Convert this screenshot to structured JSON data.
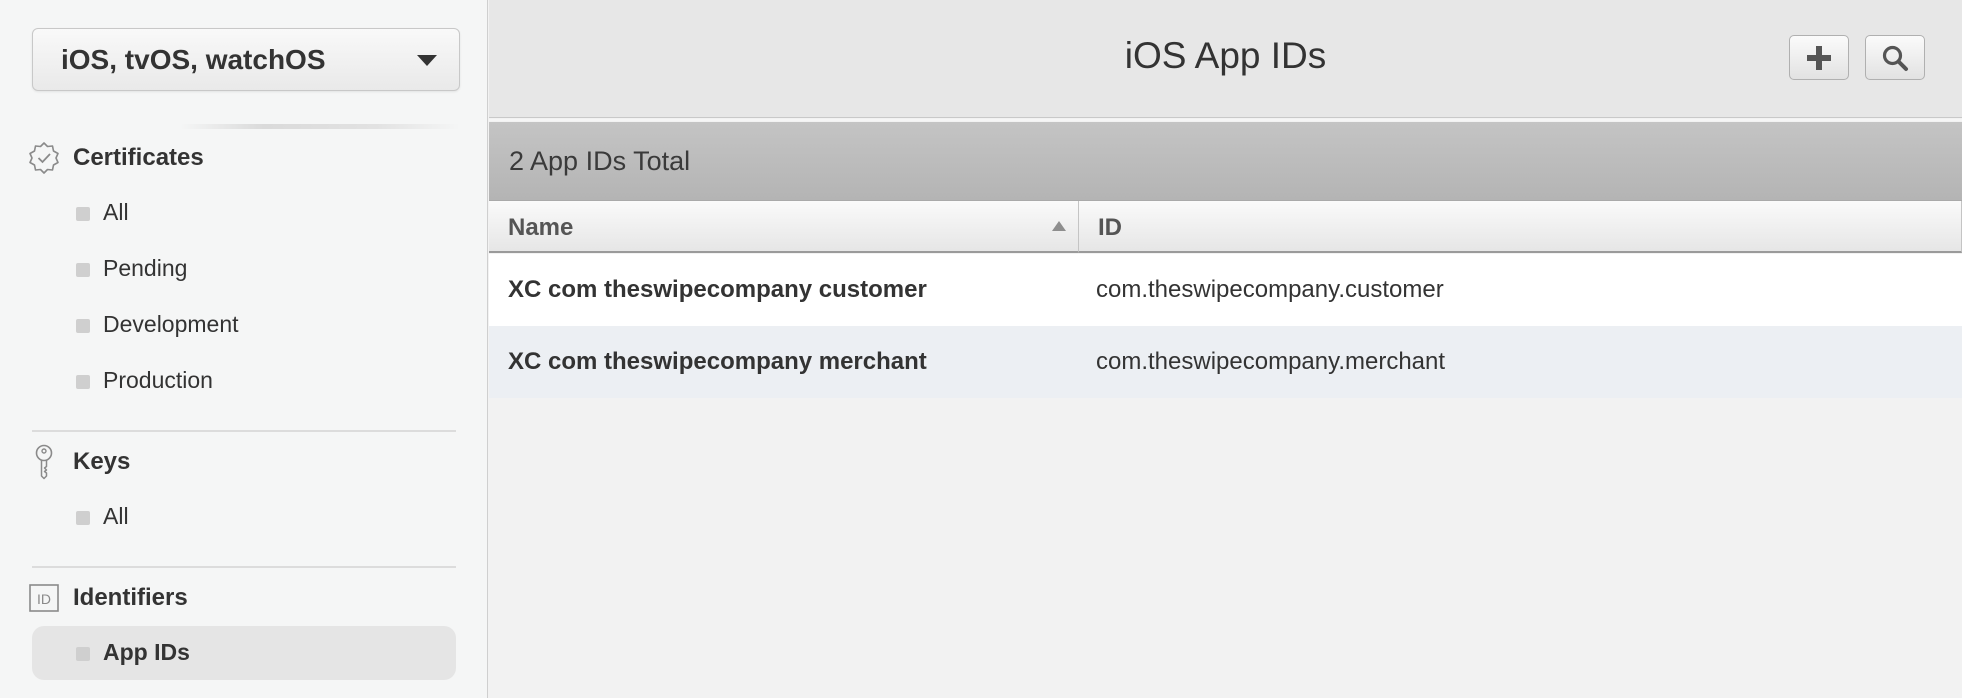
{
  "sidebar": {
    "platform_select": {
      "value": "iOS, tvOS, watchOS"
    },
    "sections": {
      "certificates": {
        "title": "Certificates",
        "icon": "badge-icon",
        "items": [
          "All",
          "Pending",
          "Development",
          "Production"
        ]
      },
      "keys": {
        "title": "Keys",
        "icon": "key-icon",
        "items": [
          "All"
        ]
      },
      "identifiers": {
        "title": "Identifiers",
        "icon": "id-icon",
        "icon_text": "ID",
        "items": [
          "App IDs"
        ],
        "active_item": "App IDs"
      }
    }
  },
  "header": {
    "title": "iOS App IDs",
    "add_icon": "plus-icon",
    "search_icon": "search-icon"
  },
  "summary": {
    "total_text": "2 App IDs Total"
  },
  "table": {
    "columns": [
      "Name",
      "ID"
    ],
    "sort_column": "Name",
    "sort_direction": "ascending",
    "rows": [
      {
        "name": "XC com theswipecompany customer",
        "id": "com.theswipecompany.customer"
      },
      {
        "name": "XC com theswipecompany merchant",
        "id": "com.theswipecompany.merchant"
      }
    ]
  },
  "colors": {
    "sidebar_bg": "#f5f6f6",
    "header_bg": "#e7e7e7",
    "total_bar_bg": "#b8b8b8",
    "row_alt_bg": "#eceff3",
    "row_bg": "#ffffff",
    "text": "#333333"
  }
}
